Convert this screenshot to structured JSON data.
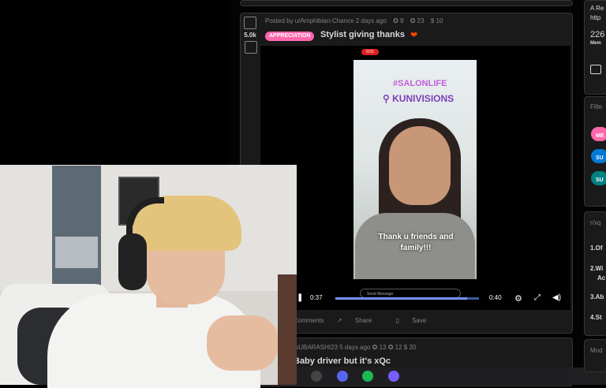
{
  "post": {
    "score": "5.0k",
    "posted_by": "Posted by u/Amphibian-Chance 2 days ago",
    "award_counts": [
      "9",
      "23",
      "10"
    ],
    "flair": "APPRECIATION",
    "title": "Stylist giving thanks",
    "heart": "❤"
  },
  "video": {
    "rec_badge": "0:01",
    "overlay_tag": "#SALONLIFE",
    "overlay_brand": "KUNIVISIONS",
    "caption": "Thank u friends and family!!!",
    "send_placeholder": "Send Message",
    "time_current": "0:37",
    "time_total": "0:40",
    "progress": 0.92
  },
  "actions": {
    "comments": "Comments",
    "share": "Share",
    "save": "Save"
  },
  "post2": {
    "posted_by": "/sUBARASHI23 5 days ago",
    "award_counts": [
      "13",
      "12",
      "20"
    ],
    "title": "Baby driver but it's xQc"
  },
  "sidebar": {
    "about_line": "A Re",
    "url_line": "http",
    "members": "226",
    "members_label": "Mem",
    "filter_heading": "Filte",
    "filter_pills": [
      {
        "label": "ME",
        "color": "#ff66ac"
      },
      {
        "label": "SU",
        "color": "#0079d3"
      },
      {
        "label": "SU",
        "color": "#008080"
      }
    ],
    "rules_heading": "r/xq",
    "rules": [
      "1.Of",
      "2.Wi",
      "Ac",
      "3.Ab",
      "4.St"
    ],
    "mod_heading": "Mod"
  },
  "taskbar": {
    "icons": [
      "chrome-icon",
      "discord-icon",
      "spotify-icon",
      "app-icon"
    ]
  }
}
